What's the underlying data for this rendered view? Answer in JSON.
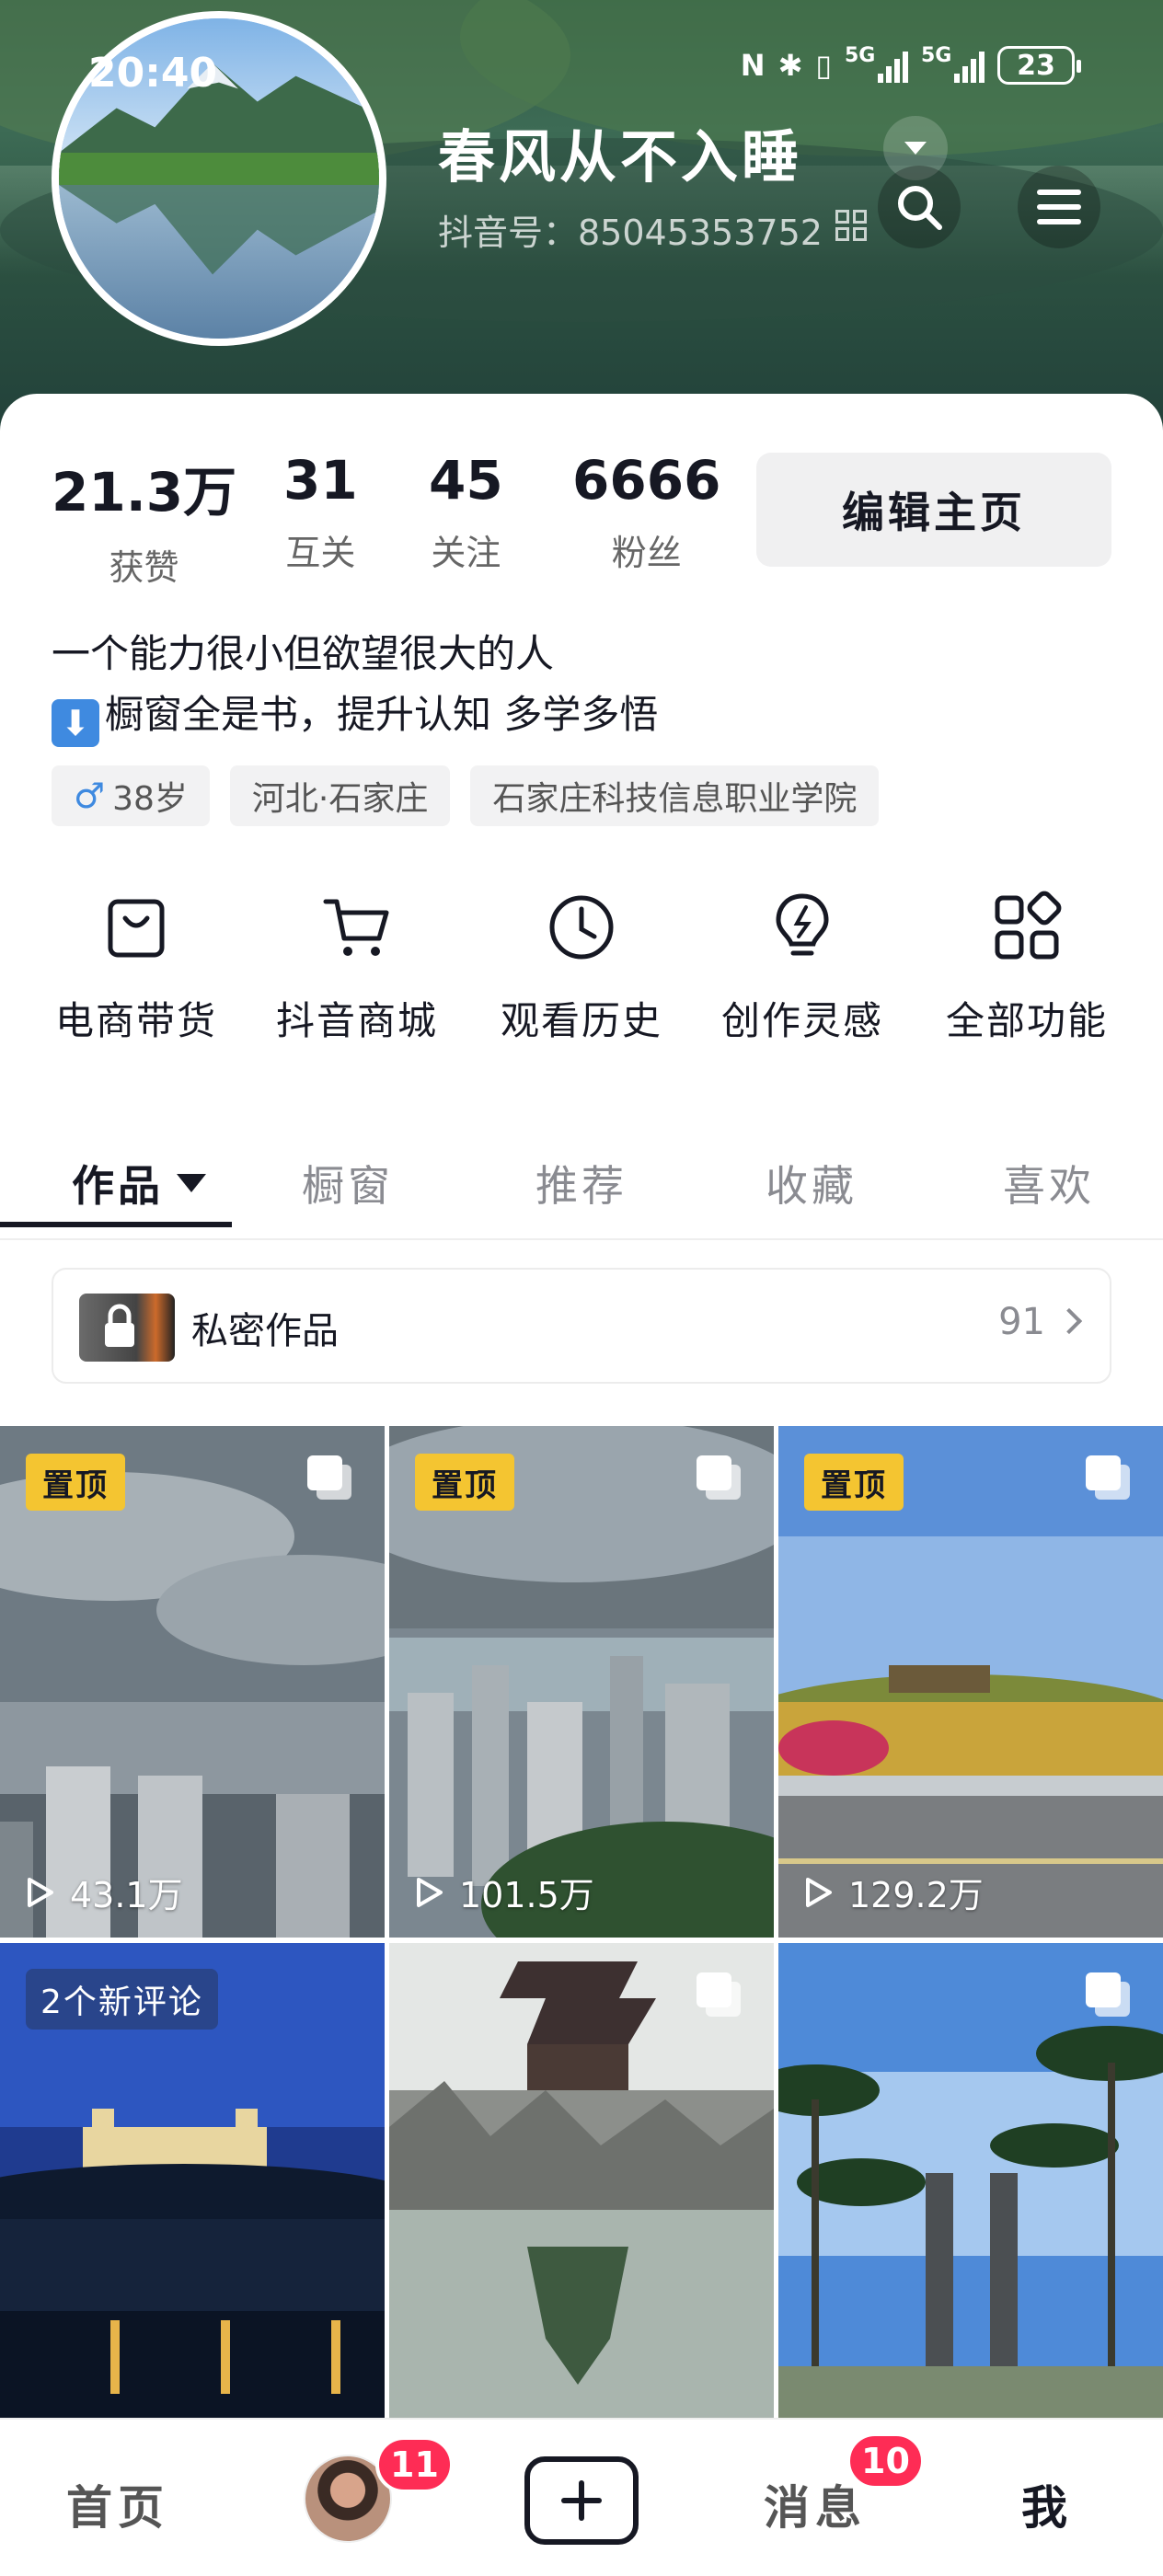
{
  "status_bar": {
    "time": "20:40",
    "nfc": "N",
    "bluetooth": "✱",
    "vibrate": "▯",
    "sim1": "5G",
    "sim2": "5G",
    "battery": "23"
  },
  "profile": {
    "nickname": "春风从不入睡",
    "douyin_id": "抖音号：85045353752"
  },
  "stats": [
    {
      "value": "21.3万",
      "label": "获赞"
    },
    {
      "value": "31",
      "label": "互关"
    },
    {
      "value": "45",
      "label": "关注"
    },
    {
      "value": "6666",
      "label": "粉丝"
    }
  ],
  "edit_button": "编辑主页",
  "bio": {
    "line1": "一个能力很小但欲望很大的人",
    "line2_emoji": "⬇",
    "line2": "橱窗全是书，提升认知 多学多悟"
  },
  "tags": {
    "gender_symbol": "♂",
    "age": "38岁",
    "location": "河北·石家庄",
    "school": "石家庄科技信息职业学院"
  },
  "functions": [
    {
      "label": "电商带货",
      "icon": "shopping-bag-icon"
    },
    {
      "label": "抖音商城",
      "icon": "cart-icon"
    },
    {
      "label": "观看历史",
      "icon": "clock-icon"
    },
    {
      "label": "创作灵感",
      "icon": "lightbulb-icon"
    },
    {
      "label": "全部功能",
      "icon": "grid-icon"
    }
  ],
  "tabs": [
    "作品",
    "橱窗",
    "推荐",
    "收藏",
    "喜欢"
  ],
  "private_works": {
    "title": "私密作品",
    "count": "91"
  },
  "videos": [
    {
      "badge": "置顶",
      "plays": "43.1万"
    },
    {
      "badge": "置顶",
      "plays": "101.5万"
    },
    {
      "badge": "置顶",
      "plays": "129.2万"
    },
    {
      "badge": "2个新评论",
      "plays": ""
    },
    {
      "badge": "",
      "plays": ""
    },
    {
      "badge": "",
      "plays": ""
    }
  ],
  "bottom_nav": {
    "home": "首页",
    "friends_badge": "11",
    "messages": "消息",
    "messages_badge": "10",
    "me": "我"
  },
  "colors": {
    "accent_badge": "#fe2c55",
    "pin_badge": "#f4c531",
    "text_primary": "#161823",
    "text_secondary": "#8a8b91"
  }
}
